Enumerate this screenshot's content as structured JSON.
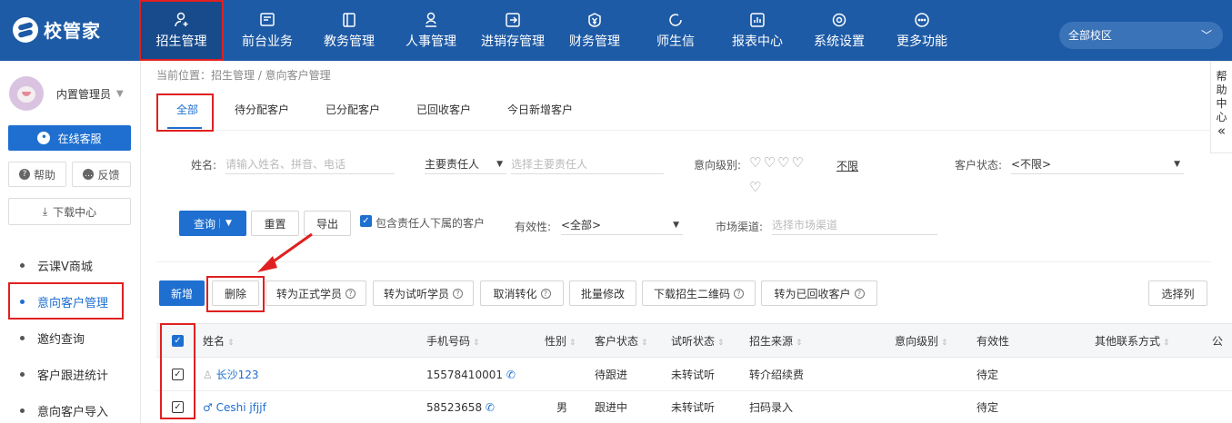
{
  "app": {
    "logo_text": "校管家",
    "campus": "全部校区"
  },
  "nav": [
    {
      "label": "招生管理",
      "icon": "user-add-icon"
    },
    {
      "label": "前台业务",
      "icon": "monitor-icon"
    },
    {
      "label": "教务管理",
      "icon": "book-icon"
    },
    {
      "label": "人事管理",
      "icon": "person-icon"
    },
    {
      "label": "进销存管理",
      "icon": "inventory-icon"
    },
    {
      "label": "财务管理",
      "icon": "finance-icon"
    },
    {
      "label": "师生信",
      "icon": "chat-icon"
    },
    {
      "label": "报表中心",
      "icon": "report-icon"
    },
    {
      "label": "系统设置",
      "icon": "settings-icon"
    },
    {
      "label": "更多功能",
      "icon": "more-icon"
    }
  ],
  "sidebar": {
    "user_name": "内置管理员",
    "service": "在线客服",
    "help": "帮助",
    "feedback": "反馈",
    "download": "下载中心",
    "items": [
      {
        "label": "云课V商城"
      },
      {
        "label": "意向客户管理"
      },
      {
        "label": "邀约查询"
      },
      {
        "label": "客户跟进统计"
      },
      {
        "label": "意向客户导入"
      }
    ]
  },
  "helper": [
    "帮",
    "助",
    "中",
    "心",
    "«"
  ],
  "breadcrumb": "当前位置：招生管理 / 意向客户管理",
  "tabs": [
    "全部",
    "待分配客户",
    "已分配客户",
    "已回收客户",
    "今日新增客户"
  ],
  "filters": {
    "name_label": "姓名:",
    "name_placeholder": "请输入姓名、拼音、电话",
    "owner_select": "主要责任人",
    "owner_placeholder": "选择主要责任人",
    "level_label": "意向级别:",
    "level_hearts": "♡♡♡♡",
    "level_hearts_extra": "♡",
    "level_nolimit": "不限",
    "status_label": "客户状态:",
    "status_value": "<不限>",
    "query": "查询",
    "reset": "重置",
    "export": "导出",
    "include_sub": "包含责任人下属的客户",
    "validity_label": "有效性:",
    "validity_value": "<全部>",
    "channel_label": "市场渠道:",
    "channel_placeholder": "选择市场渠道"
  },
  "actions": {
    "new": "新增",
    "delete": "删除",
    "to_formal": "转为正式学员",
    "to_trial": "转为试听学员",
    "cancel_convert": "取消转化",
    "batch_edit": "批量修改",
    "download_qr": "下载招生二维码",
    "to_recycled": "转为已回收客户",
    "choose_cols": "选择列"
  },
  "table": {
    "headers": [
      "姓名",
      "手机号码",
      "性别",
      "客户状态",
      "试听状态",
      "招生来源",
      "意向级别",
      "有效性",
      "其他联系方式",
      "公"
    ],
    "rows": [
      {
        "name": "长沙123",
        "phone": "15578410001",
        "gender": "",
        "status": "待跟进",
        "trial": "未转试听",
        "source": "转介绍续费",
        "level": "",
        "valid": "待定",
        "other": ""
      },
      {
        "name": "Ceshi jfjjf",
        "phone": "58523658",
        "gender": "男",
        "status": "跟进中",
        "trial": "未转试听",
        "source": "扫码录入",
        "level": "",
        "valid": "待定",
        "other": ""
      }
    ]
  },
  "colors": {
    "brand": "#1e5ba6",
    "primary": "#1e6fd0",
    "highlight": "#e02020"
  }
}
